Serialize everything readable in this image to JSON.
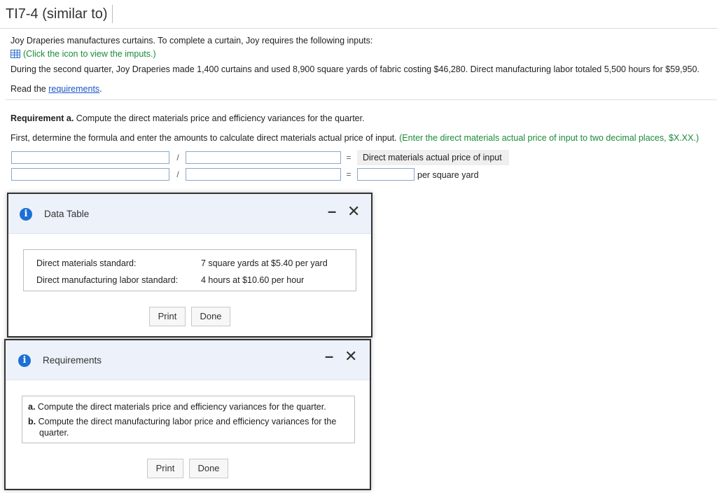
{
  "header": {
    "title": "TI7-4 (similar to)"
  },
  "problem": {
    "intro": "Joy Draperies manufactures curtains. To complete a curtain, Joy requires the following inputs:",
    "inputs_link": "(Click the icon to view the imputs.)",
    "details": "During the second quarter, Joy Draperies made 1,400 curtains and used 8,900 square yards of fabric costing $46,280. Direct manufacturing labor totaled 5,500 hours for $59,950.",
    "read_prefix": "Read the ",
    "read_link": "requirements",
    "read_suffix": "."
  },
  "requirement_a": {
    "label": "Requirement a.",
    "text": " Compute the direct materials price and efficiency variances for the quarter.",
    "first_text": "First, determine the formula and enter the amounts to calculate direct materials actual price of input.",
    "first_hint": " (Enter the direct materials actual price of input to two decimal places, $X.XX.)",
    "divide_symbol": "/",
    "equals_symbol": "=",
    "result_label": "Direct materials actual price of input",
    "unit_label": "per square yard"
  },
  "data_table_modal": {
    "title": "Data Table",
    "minimize": "–",
    "close": "✕",
    "rows": [
      {
        "label": "Direct materials standard:",
        "value": "7 square yards at $5.40 per yard"
      },
      {
        "label": "Direct manufacturing labor standard:",
        "value": "4 hours at $10.60 per hour"
      }
    ],
    "print_label": "Print",
    "done_label": "Done"
  },
  "requirements_modal": {
    "title": "Requirements",
    "minimize": "–",
    "close": "✕",
    "items": [
      {
        "letter": "a.",
        "text": "Compute the direct materials price and efficiency variances for the quarter."
      },
      {
        "letter": "b.",
        "text": "Compute the direct manufacturing labor price and efficiency variances for the quarter."
      }
    ],
    "print_label": "Print",
    "done_label": "Done"
  },
  "icons": {
    "info": "i"
  }
}
